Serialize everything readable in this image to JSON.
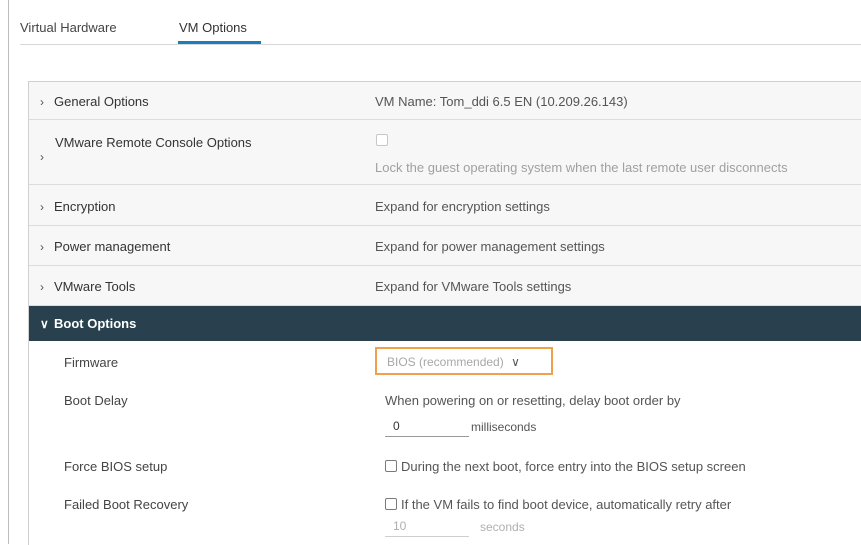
{
  "tabs": [
    {
      "label": "Virtual Hardware"
    },
    {
      "label": "VM Options"
    }
  ],
  "rows": {
    "general": {
      "label": "General Options",
      "value": "VM Name: Tom_ddi 6.5 EN (10.209.26.143)"
    },
    "vmrc": {
      "label": "VMware Remote Console Options",
      "value": "Lock the guest operating system when the last remote user disconnects"
    },
    "encryption": {
      "label": "Encryption",
      "value": "Expand for encryption settings"
    },
    "power": {
      "label": "Power management",
      "value": "Expand for power management settings"
    },
    "tools": {
      "label": "VMware Tools",
      "value": "Expand for VMware Tools settings"
    }
  },
  "boot": {
    "label": "Boot Options",
    "firmware": {
      "label": "Firmware",
      "selected": "BIOS (recommended)"
    },
    "delay": {
      "label": "Boot Delay",
      "desc": "When powering on or resetting, delay boot order by",
      "value": "0",
      "unit": "milliseconds"
    },
    "force_bios": {
      "label": "Force BIOS setup",
      "desc": "During the next boot, force entry into the BIOS setup screen"
    },
    "failed": {
      "label": "Failed Boot Recovery",
      "desc": "If the VM fails to find boot device, automatically retry after",
      "value": "10",
      "unit": "seconds"
    }
  },
  "icons": {
    "collapsed": "chevron-right-icon",
    "expanded": "chevron-down-icon"
  },
  "colors": {
    "accent": "#1a7ebd",
    "header_bg": "#29414e",
    "focus_border": "#f0a04b"
  }
}
